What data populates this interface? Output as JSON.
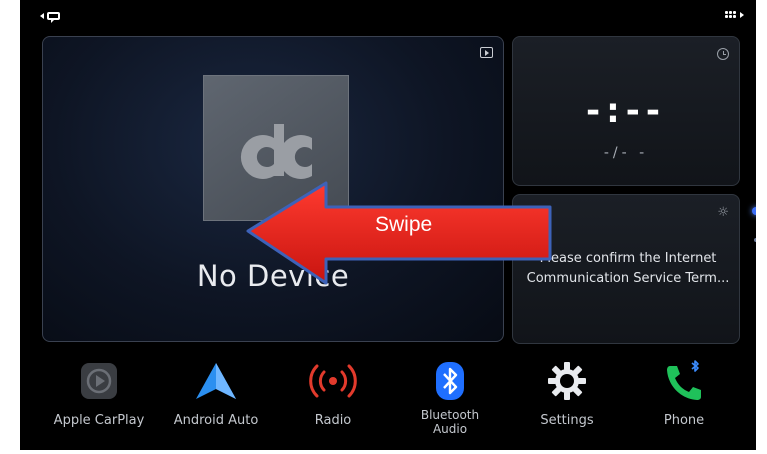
{
  "media": {
    "status": "No Device"
  },
  "clock": {
    "time": "-:--",
    "date": "-/- -"
  },
  "notice": {
    "message": "Please confirm the Internet Communication Service Term..."
  },
  "annotation": {
    "swipe_label": "Swipe",
    "arrow_color": "#e8251e"
  },
  "dock": {
    "items": [
      {
        "label": "Apple CarPlay",
        "icon": "carplay-icon"
      },
      {
        "label": "Android Auto",
        "icon": "android-auto-icon"
      },
      {
        "label": "Radio",
        "icon": "radio-icon"
      },
      {
        "label": "Bluetooth\nAudio",
        "icon": "bluetooth-icon"
      },
      {
        "label": "Settings",
        "icon": "gear-icon"
      },
      {
        "label": "Phone",
        "icon": "phone-icon"
      }
    ]
  },
  "colors": {
    "accent_blue": "#3b6df6",
    "radio_red": "#e23a2c",
    "phone_green": "#1fc15a",
    "android_blue": "#2b8ff0"
  }
}
